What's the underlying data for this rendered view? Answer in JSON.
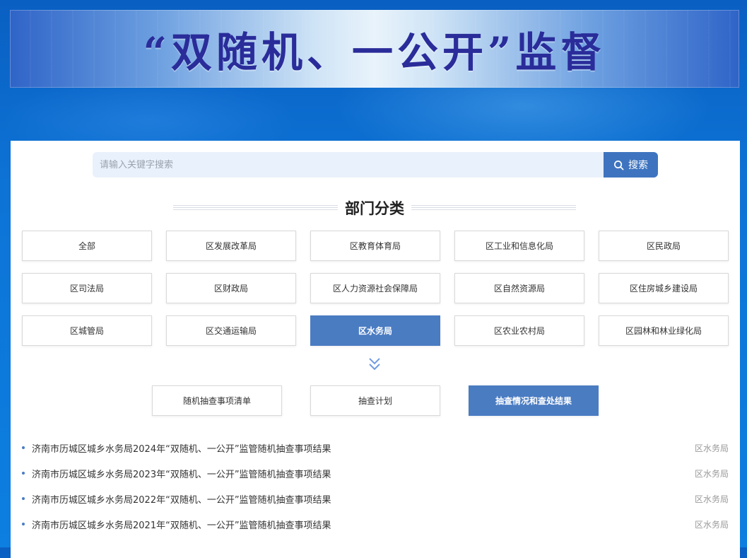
{
  "banner": {
    "title": "“双随机、一公开”监督"
  },
  "search": {
    "placeholder": "请输入关键字搜索",
    "button_label": "搜索"
  },
  "section": {
    "title": "部门分类"
  },
  "departments": [
    [
      "全部",
      "区发展改革局",
      "区教育体育局",
      "区工业和信息化局",
      "区民政局"
    ],
    [
      "区司法局",
      "区财政局",
      "区人力资源社会保障局",
      "区自然资源局",
      "区住房城乡建设局"
    ],
    [
      "区城管局",
      "区交通运输局",
      "区水务局",
      "区农业农村局",
      "区园林和林业绿化局"
    ]
  ],
  "active_department": "区水务局",
  "tabs": [
    "随机抽查事项清单",
    "抽查计划",
    "抽查情况和查处结果"
  ],
  "active_tab": "抽查情况和查处结果",
  "results": [
    {
      "title": "济南市历城区城乡水务局2024年“双随机、一公开”监管随机抽查事项结果",
      "dept": "区水务局"
    },
    {
      "title": "济南市历城区城乡水务局2023年“双随机、一公开”监管随机抽查事项结果",
      "dept": "区水务局"
    },
    {
      "title": "济南市历城区城乡水务局2022年“双随机、一公开”监管随机抽查事项结果",
      "dept": "区水务局"
    },
    {
      "title": "济南市历城区城乡水务局2021年“双随机、一公开”监管随机抽查事项结果",
      "dept": "区水务局"
    }
  ],
  "colors": {
    "accent": "#4a7cc2",
    "search_button": "#3e74bf",
    "banner_text": "#2a2c9a"
  },
  "icons": {
    "search": "search-icon",
    "expand": "double-chevron-down-icon"
  }
}
